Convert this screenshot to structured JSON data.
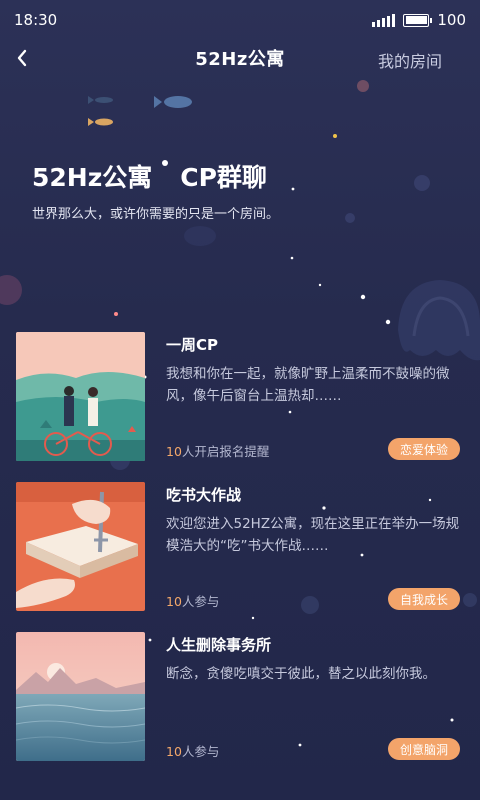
{
  "status_bar": {
    "time": "18:30",
    "battery": "100",
    "signal_icon": "signal-icon",
    "battery_icon": "battery-icon"
  },
  "nav": {
    "back_icon": "chevron-left-icon",
    "title": "52Hz公寓",
    "right_link": "我的房间"
  },
  "hero": {
    "title_left": "52Hz公寓",
    "title_right": "CP群聊",
    "subtitle": "世界那么大，或许你需要的只是一个房间。"
  },
  "rooms": [
    {
      "title": "一周CP",
      "description": "我想和你在一起，就像旷野上温柔而不鼓噪的微风，像午后窗台上温热却……",
      "count_num": "10",
      "count_text": "人开启报名提醒",
      "tag": "恋爱体验"
    },
    {
      "title": "吃书大作战",
      "description": "欢迎您进入52HZ公寓，现在这里正在举办一场规模浩大的“吃”书大作战……",
      "count_num": "10",
      "count_text": "人参与",
      "tag": "自我成长"
    },
    {
      "title": "人生删除事务所",
      "description": "断念，贪傻吃嗔交于彼此，替之以此刻你我。",
      "count_num": "10",
      "count_text": "人参与",
      "tag": "创意脑洞"
    }
  ],
  "colors": {
    "background": "#262b4e",
    "accent": "#f3a46a",
    "text_muted": "#c6c9dd"
  }
}
